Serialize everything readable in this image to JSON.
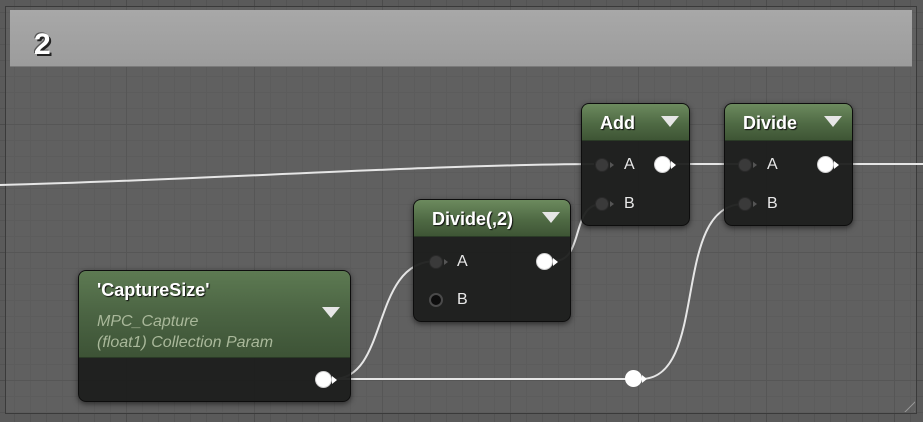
{
  "comment": {
    "title": "2"
  },
  "nodes": {
    "param": {
      "name": "'CaptureSize'",
      "line1": "MPC_Capture",
      "line2": "(float1) Collection Param"
    },
    "divide_const": {
      "title": "Divide(,2)",
      "pin_a": "A",
      "pin_b": "B"
    },
    "add": {
      "title": "Add",
      "pin_a": "A",
      "pin_b": "B"
    },
    "divide": {
      "title": "Divide",
      "pin_a": "A",
      "pin_b": "B"
    }
  },
  "colors": {
    "node_header_green": "#4f6a44",
    "wire": "#e6e6e6",
    "comment_header": "#a3a3a3",
    "param_subtitle": "#a9b89a"
  },
  "icons": [
    "dropdown-arrow-icon",
    "resize-grip-icon",
    "pin-icon"
  ]
}
